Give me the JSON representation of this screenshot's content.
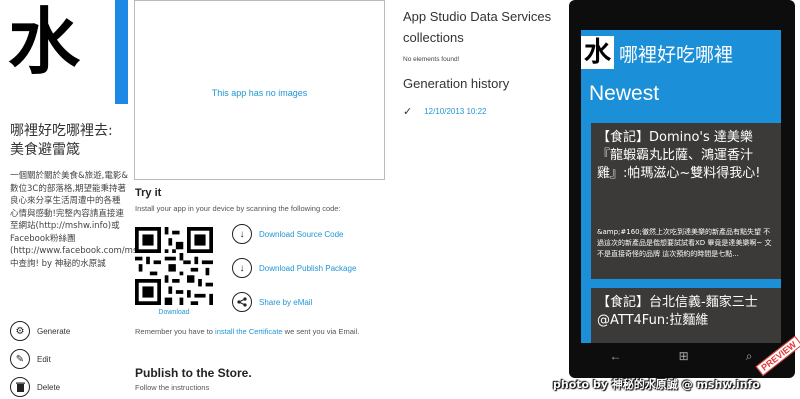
{
  "app": {
    "logo_char": "水",
    "title": "哪裡好吃哪裡去:美食避雷箴",
    "description": "一個關於關於美食&旅遊,電影&數位3C的部落格,期望能秉持著良心來分享生活周遭中的各種心情與感動!完整內容請直接連至網站(http://mshw.info)或Facebook粉絲團(http://www.facebook.com/mshw.info)中查詢! by 神秘的水原誠"
  },
  "actions": [
    {
      "label": "Generate",
      "icon": "gear-icon"
    },
    {
      "label": "Edit",
      "icon": "pencil-icon"
    },
    {
      "label": "Delete",
      "icon": "trash-icon"
    }
  ],
  "images": {
    "placeholder": "This app has no images"
  },
  "try_it": {
    "title": "Try it",
    "description": "Install your app in your device by scanning the following code:",
    "qr_caption": "Download",
    "links": [
      {
        "label": "Download Source Code",
        "icon": "download-icon"
      },
      {
        "label": "Download Publish Package",
        "icon": "download-icon"
      },
      {
        "label": "Share by eMail",
        "icon": "share-icon"
      }
    ],
    "remember_prefix": "Remember you have to ",
    "remember_link": "install the Certificate",
    "remember_suffix": " we sent you via Email."
  },
  "publish": {
    "title": "Publish to the Store.",
    "subtitle": "Follow the instructions"
  },
  "data_services": {
    "title": "App Studio Data Services collections",
    "empty": "No elements found!"
  },
  "generation": {
    "title": "Generation history",
    "entries": [
      "12/10/2013 10:22"
    ]
  },
  "phone": {
    "title": "哪裡好吃哪裡",
    "section": "Newest",
    "cards": [
      {
        "title": "【食記】Domino's 達美樂『龍蝦霸丸比薩、鴻運香汁雞』:帕瑪滋心~雙料得我心!",
        "body": "&amp;#160;徹然上次吃到達美樂的新產品有點失望 不過這次的新產品是偕想要試試看XD 畢竟是達美樂啊~ 文不是直接奇怪的品牌 這次預約的時間是七點..."
      },
      {
        "title": "【食記】台北信義-麵家三士@ATT4Fun:拉麵維",
        "body": ""
      }
    ],
    "badge": "PREVIEW"
  },
  "watermark": "photo by 神秘的水原誠 @ mshw.info",
  "colors": {
    "accent": "#1e88e5",
    "link": "#2196d3",
    "phone_bg": "#1b8fd8",
    "card_bg": "#3b3a39"
  }
}
